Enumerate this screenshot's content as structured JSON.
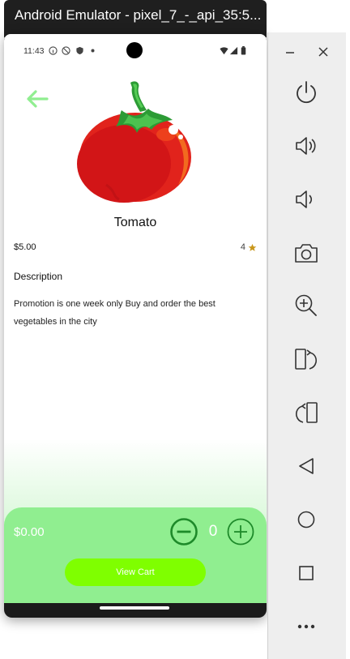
{
  "window": {
    "title": "Android Emulator - pixel_7_-_api_35:5..."
  },
  "status_bar": {
    "time": "11:43"
  },
  "product": {
    "name": "Tomato",
    "price": "$5.00",
    "rating": "4",
    "description_heading": "Description",
    "description": "Promotion is one week only Buy and order the best vegetables in the city",
    "image_icon": "tomato-icon"
  },
  "cart": {
    "total": "$0.00",
    "quantity": "0",
    "view_cart_label": "View Cart"
  },
  "colors": {
    "accent_green": "#90ee90",
    "button_lime": "#7fff00",
    "back_arrow": "#90ee90",
    "star": "#c9971c"
  },
  "toolbar": {
    "items": [
      "minimize-icon",
      "close-icon",
      "power-icon",
      "volume-up-icon",
      "volume-down-icon",
      "camera-icon",
      "zoom-icon",
      "rotate-left-icon",
      "rotate-right-icon",
      "back-icon",
      "home-icon",
      "overview-icon",
      "more-icon"
    ]
  }
}
